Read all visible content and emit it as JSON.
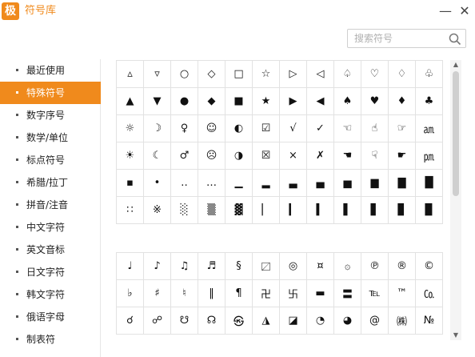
{
  "window": {
    "logo_text": "极",
    "title": "符号库",
    "minimize_glyph": "—",
    "close_glyph": "✕"
  },
  "search": {
    "placeholder": "搜索符号",
    "value": ""
  },
  "sidebar": {
    "items": [
      {
        "label": "最近使用",
        "active": false
      },
      {
        "label": "特殊符号",
        "active": true
      },
      {
        "label": "数字序号",
        "active": false
      },
      {
        "label": "数学/单位",
        "active": false
      },
      {
        "label": "标点符号",
        "active": false
      },
      {
        "label": "希腊/拉丁",
        "active": false
      },
      {
        "label": "拼音/注音",
        "active": false
      },
      {
        "label": "中文字符",
        "active": false
      },
      {
        "label": "英文音标",
        "active": false
      },
      {
        "label": "日文字符",
        "active": false
      },
      {
        "label": "韩文字符",
        "active": false
      },
      {
        "label": "俄语字母",
        "active": false
      },
      {
        "label": "制表符",
        "active": false
      }
    ]
  },
  "symbol_grids": [
    {
      "rows": [
        [
          "▵",
          "▿",
          "○",
          "◇",
          "□",
          "☆",
          "▷",
          "◁",
          "♤",
          "♡",
          "♢",
          "♧"
        ],
        [
          "▲",
          "▼",
          "●",
          "◆",
          "■",
          "★",
          "▶",
          "◀",
          "♠",
          "♥",
          "♦",
          "♣"
        ],
        [
          "☼",
          "☽",
          "♀",
          "☺",
          "◐",
          "☑",
          "√",
          "✓",
          "☜",
          "☝",
          "☞",
          "㏂"
        ],
        [
          "☀",
          "☾",
          "♂",
          "☹",
          "◑",
          "☒",
          "×",
          "✗",
          "☚",
          "☟",
          "☛",
          "㏘"
        ],
        [
          "▪",
          "•",
          "‥",
          "…",
          "▁",
          "▂",
          "▃",
          "▄",
          "▅",
          "▆",
          "▇",
          "█"
        ],
        [
          "∷",
          "※",
          "░",
          "▒",
          "▓",
          "▏",
          "▎",
          "▍",
          "▌",
          "▋",
          "▊",
          "▉"
        ]
      ]
    },
    {
      "rows": [
        [
          "♩",
          "♪",
          "♫",
          "♬",
          "§",
          "〼",
          "◎",
          "¤",
          "۞",
          "℗",
          "®",
          "©"
        ],
        [
          "♭",
          "♯",
          "♮",
          "‖",
          "¶",
          "卍",
          "卐",
          "▬",
          "〓",
          "℡",
          "™",
          "㏇"
        ],
        [
          "☌",
          "☍",
          "☋",
          "☊",
          "㉿",
          "◮",
          "◪",
          "◔",
          "◕",
          "@",
          "㈱",
          "№"
        ]
      ]
    }
  ],
  "scrollbar": {
    "up_glyph": "▲",
    "down_glyph": "▼"
  },
  "colors": {
    "accent": "#f08a1c",
    "grid_border": "#e2e2e2",
    "sidebar_divider": "#e6e6e6"
  }
}
